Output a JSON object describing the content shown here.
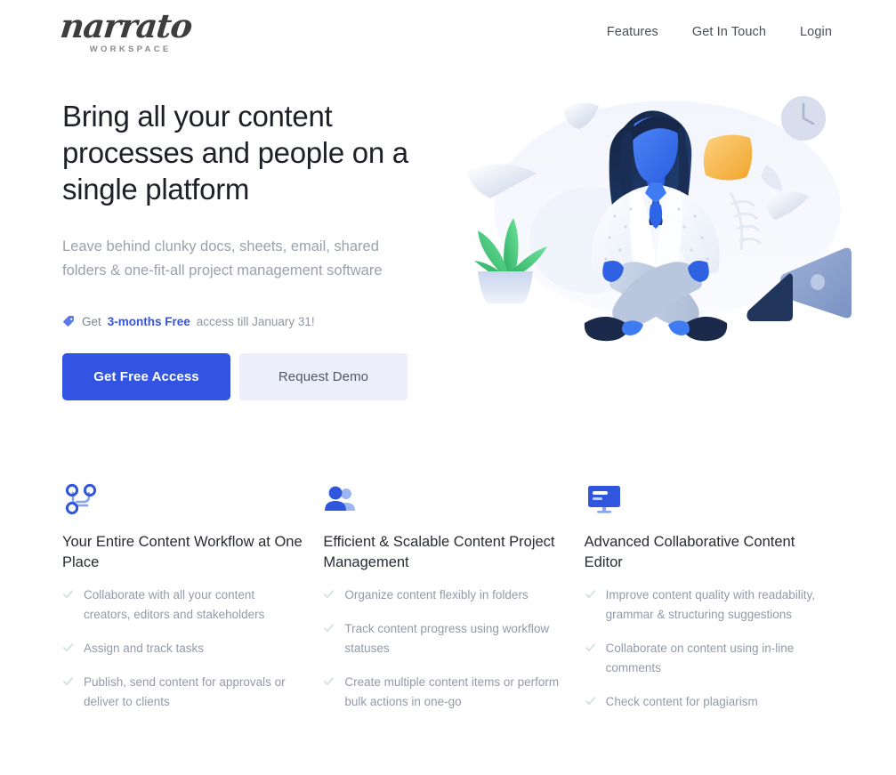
{
  "brand": {
    "name": "narrato",
    "tagline": "WORKSPACE",
    "logo_color": "#3d3d3d"
  },
  "nav": {
    "items": [
      {
        "label": "Features"
      },
      {
        "label": "Get In Touch"
      },
      {
        "label": "Login"
      }
    ]
  },
  "hero": {
    "headline": "Bring all your content processes and people on a single platform",
    "subhead": "Leave behind clunky docs, sheets, email, shared folders & one-fit-all project management software",
    "promo": {
      "icon": "price-tag-icon",
      "prefix": "Get",
      "highlight": "3-months Free",
      "suffix": "access till January 31!",
      "highlight_color": "#3353e2"
    },
    "cta_primary": {
      "label": "Get Free Access",
      "color": "#3353e2"
    },
    "cta_secondary": {
      "label": "Request Demo",
      "color": "#eceffb"
    },
    "illustration": {
      "name": "woman-meditating-illustration",
      "elements": [
        "meditating-woman",
        "floating-papers",
        "wall-clock",
        "sticky-note",
        "potted-plant",
        "laptop"
      ],
      "accent_colors": {
        "blob": "#f3f5fb",
        "skin": "#3b71f0",
        "hair": "#18294f",
        "shirt": "#ffffff",
        "tie": "#2f6fef",
        "pants": "#c3cee0",
        "shoes": "#1b2a4a",
        "sticky_note": "#f5b23d",
        "plant_leaf": "#4cc47c",
        "laptop": "#8aa0cc",
        "clock": "#c9d2e6"
      }
    }
  },
  "features": {
    "columns": [
      {
        "icon": "workflow-nodes-icon",
        "title": "Your Entire Content Workflow at One Place",
        "bullets": [
          "Collaborate with all your content creators, editors and stakeholders",
          "Assign and track tasks",
          "Publish, send content for approvals or deliver to clients"
        ]
      },
      {
        "icon": "users-group-icon",
        "title": "Efficient & Scalable Content Project Management",
        "bullets": [
          "Organize content flexibly in folders",
          "Track content progress using workflow statuses",
          "Create multiple content items or perform bulk actions in one-go"
        ]
      },
      {
        "icon": "monitor-editor-icon",
        "title": "Advanced Collaborative Content Editor",
        "bullets": [
          "Improve content quality with readability, grammar & structuring suggestions",
          "Collaborate on content using in-line comments",
          "Check content for plagiarism"
        ]
      }
    ],
    "check_color": "#cfe3d6"
  }
}
